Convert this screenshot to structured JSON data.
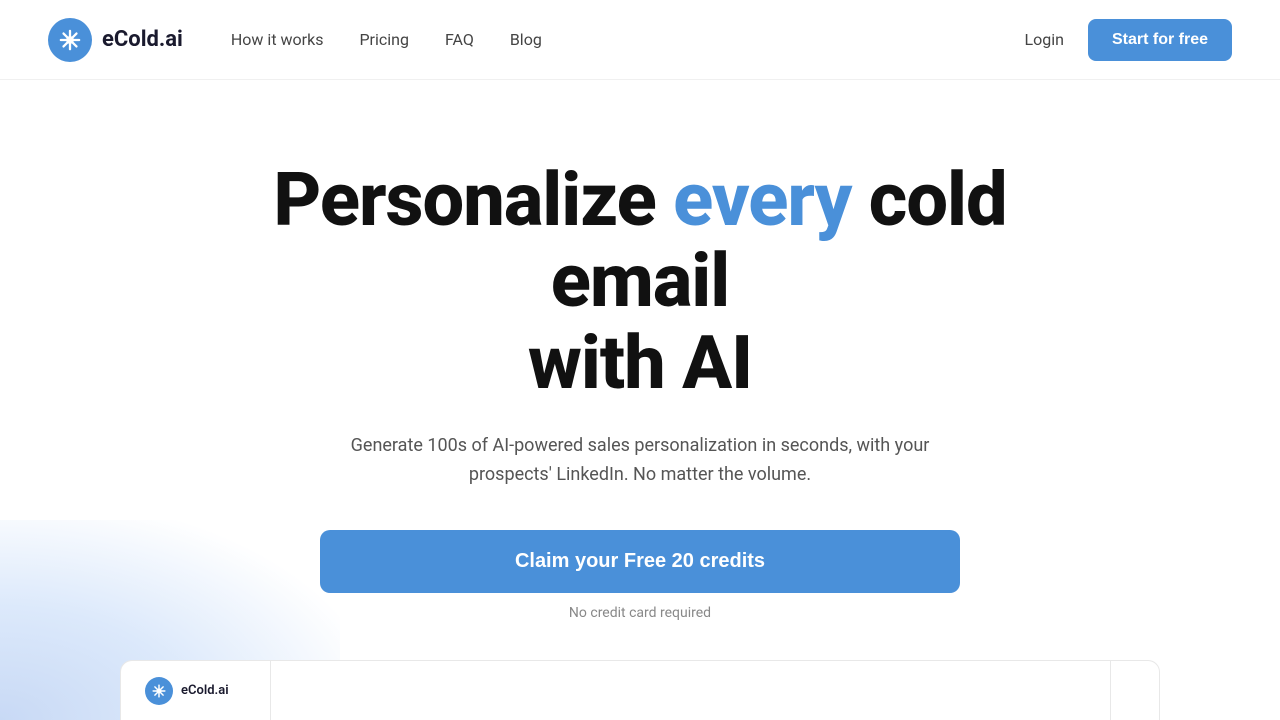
{
  "brand": {
    "logo_icon": "❄",
    "name": "eCold.ai"
  },
  "nav": {
    "links": [
      {
        "label": "How it works",
        "id": "how-it-works"
      },
      {
        "label": "Pricing",
        "id": "pricing"
      },
      {
        "label": "FAQ",
        "id": "faq"
      },
      {
        "label": "Blog",
        "id": "blog"
      }
    ],
    "login_label": "Login",
    "cta_label": "Start for free"
  },
  "hero": {
    "title_part1": "Personalize ",
    "title_highlight": "every",
    "title_part2": " cold email",
    "title_line2": "with AI",
    "subtitle": "Generate 100s of AI-powered sales personalization in seconds, with your prospects' LinkedIn. No matter the volume.",
    "cta_label": "Claim your Free 20 credits",
    "no_credit_text": "No credit card required"
  },
  "colors": {
    "brand_blue": "#4a90d9",
    "text_dark": "#111111",
    "text_muted": "#555555",
    "text_light": "#888888"
  }
}
